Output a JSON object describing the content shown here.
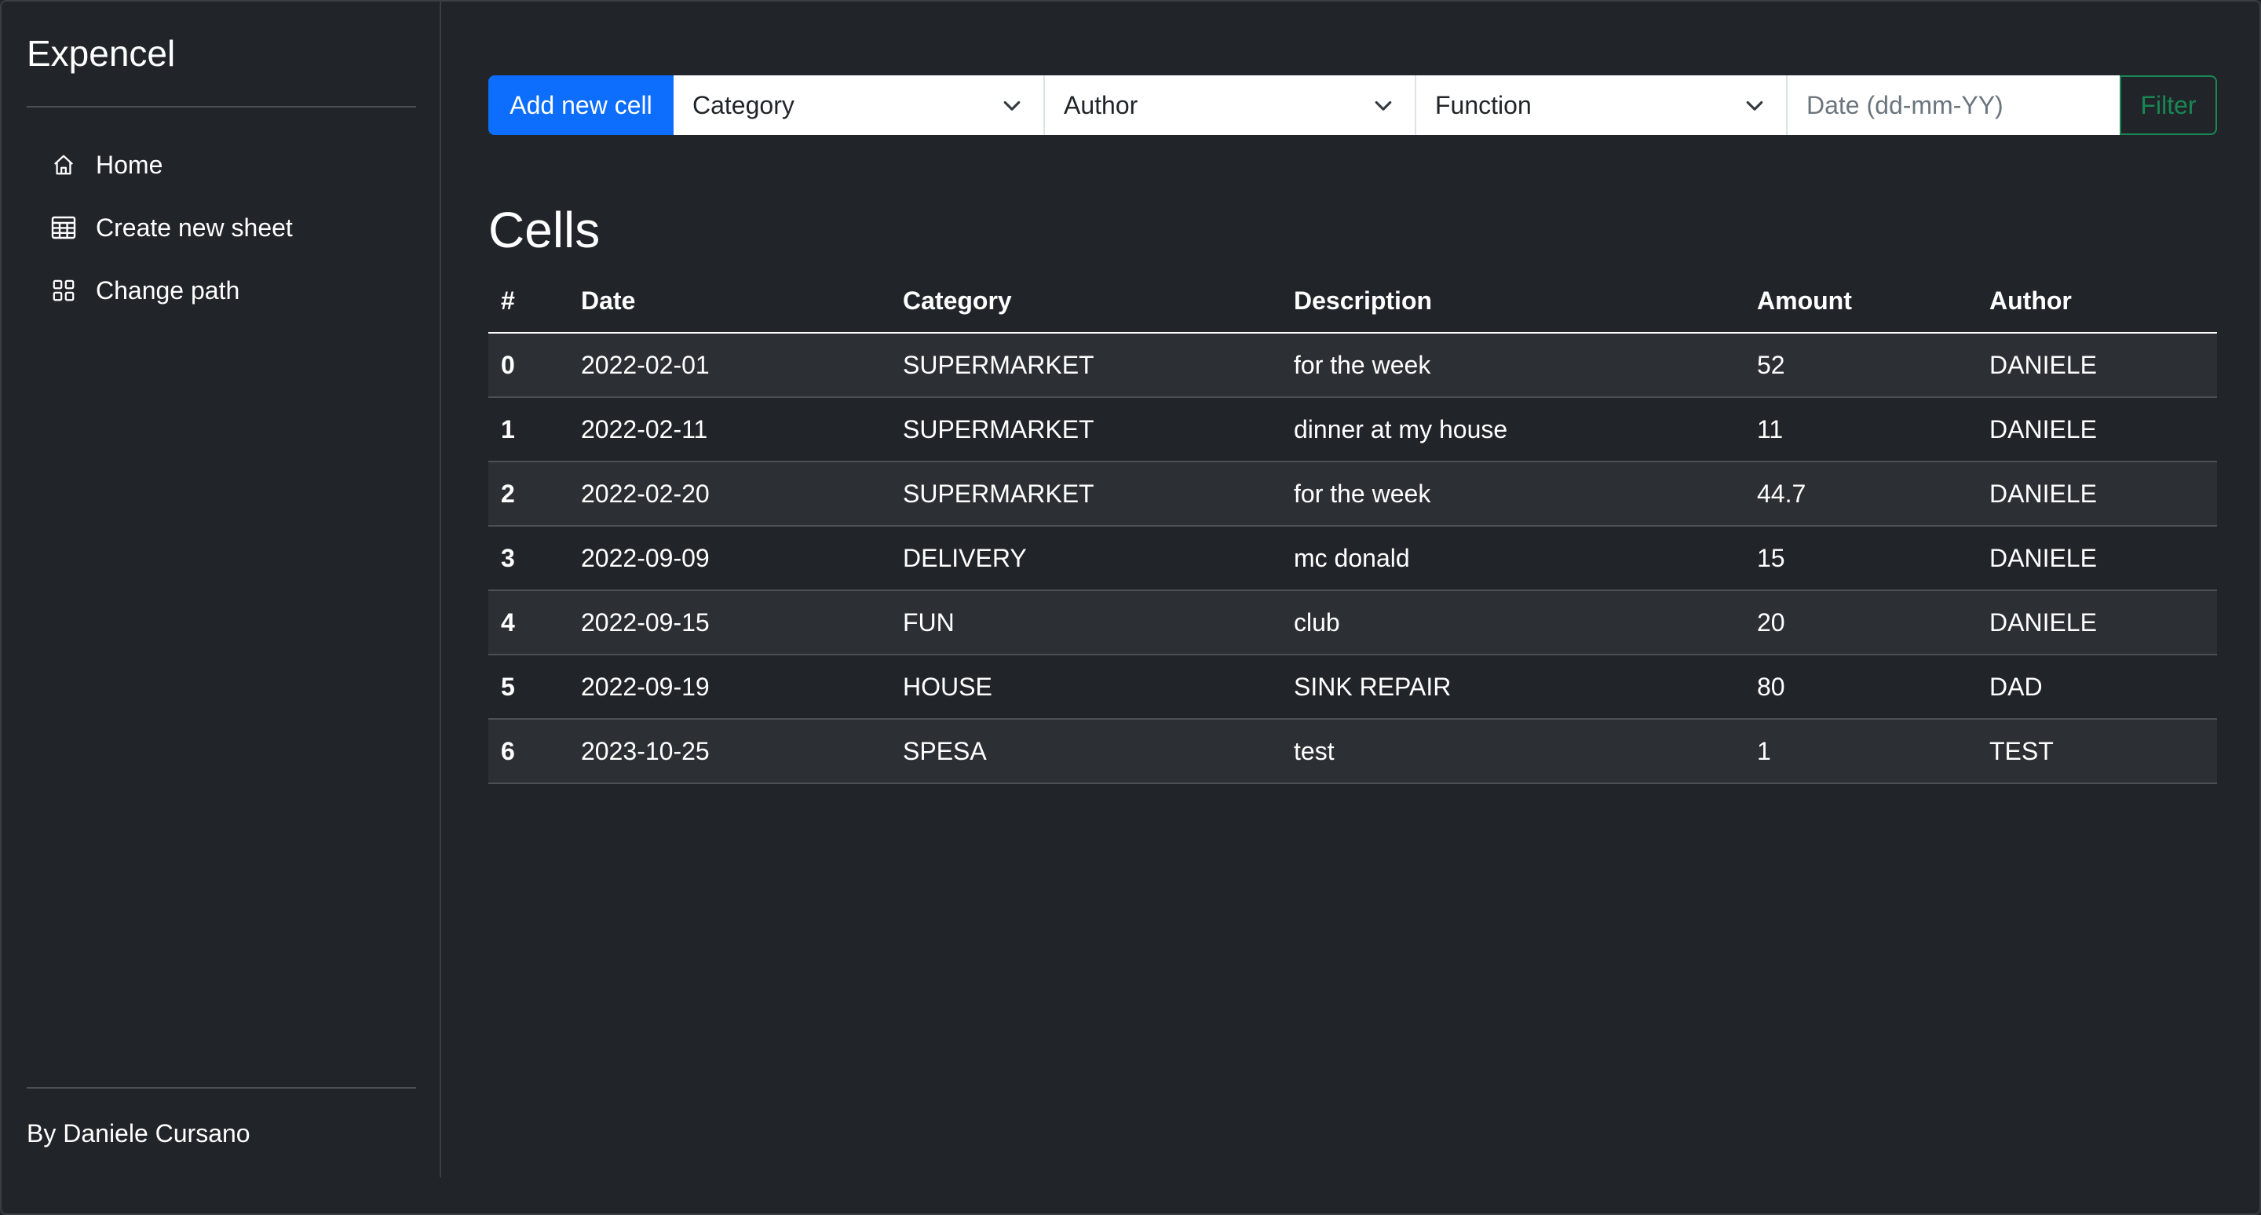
{
  "app": {
    "title": "Expencel",
    "footer": "By Daniele Cursano"
  },
  "sidebar": {
    "items": [
      {
        "label": "Home",
        "icon": "house-icon"
      },
      {
        "label": "Create new sheet",
        "icon": "table-icon"
      },
      {
        "label": "Change path",
        "icon": "grid-icon"
      }
    ]
  },
  "toolbar": {
    "add_label": "Add new cell",
    "category_select": "Category",
    "author_select": "Author",
    "function_select": "Function",
    "date_placeholder": "Date (dd-mm-YY)",
    "filter_label": "Filter"
  },
  "main": {
    "title": "Cells"
  },
  "table": {
    "headers": [
      "#",
      "Date",
      "Category",
      "Description",
      "Amount",
      "Author"
    ],
    "rows": [
      [
        "0",
        "2022-02-01",
        "SUPERMARKET",
        "for the week",
        "52",
        "DANIELE"
      ],
      [
        "1",
        "2022-02-11",
        "SUPERMARKET",
        "dinner at my house",
        "11",
        "DANIELE"
      ],
      [
        "2",
        "2022-02-20",
        "SUPERMARKET",
        "for the week",
        "44.7",
        "DANIELE"
      ],
      [
        "3",
        "2022-09-09",
        "DELIVERY",
        "mc donald",
        "15",
        "DANIELE"
      ],
      [
        "4",
        "2022-09-15",
        "FUN",
        "club",
        "20",
        "DANIELE"
      ],
      [
        "5",
        "2022-09-19",
        "HOUSE",
        "SINK REPAIR",
        "80",
        "DAD"
      ],
      [
        "6",
        "2023-10-25",
        "SPESA",
        "test",
        "1",
        "TEST"
      ]
    ]
  },
  "colors": {
    "background": "#212529",
    "primary": "#0d6efd",
    "success": "#198754",
    "striped_row": "#2c3034"
  }
}
